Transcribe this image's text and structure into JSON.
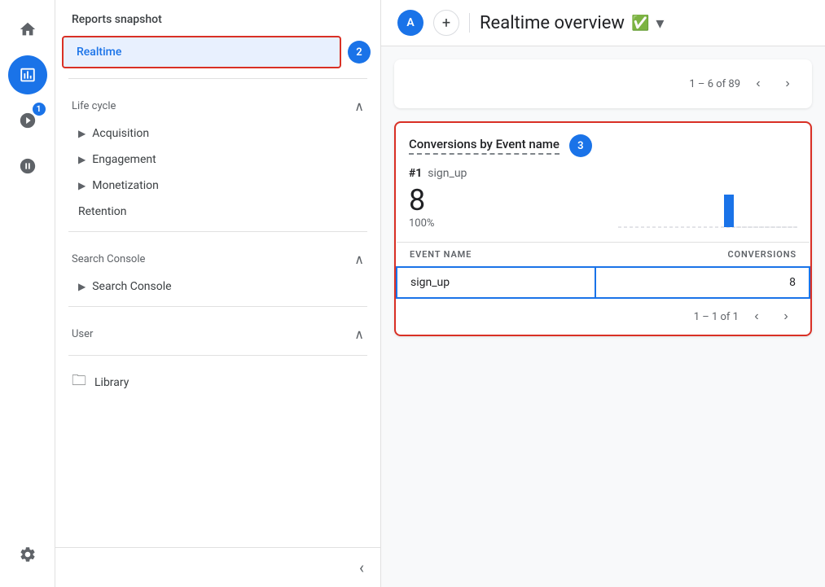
{
  "iconbar": {
    "home_label": "home",
    "reports_label": "reports",
    "advertising_label": "advertising",
    "explore_label": "explore",
    "settings_label": "settings",
    "badge_value": "1"
  },
  "sidebar": {
    "header": "Reports snapshot",
    "realtime_label": "Realtime",
    "lifecycle_label": "Life cycle",
    "acquisition_label": "Acquisition",
    "engagement_label": "Engagement",
    "monetization_label": "Monetization",
    "retention_label": "Retention",
    "search_console_section": "Search Console",
    "search_console_item": "Search Console",
    "user_label": "User",
    "library_label": "Library",
    "collapse_icon": "‹"
  },
  "header": {
    "avatar_label": "A",
    "add_label": "+",
    "page_title": "Realtime overview",
    "step_label": "2"
  },
  "top_card": {
    "pagination_text": "1 – 6 of 89",
    "prev_icon": "‹",
    "next_icon": "›"
  },
  "conversions_card": {
    "title": "Conversions by Event name",
    "step_label": "3",
    "rank": "#1",
    "event_name": "sign_up",
    "big_number": "8",
    "percent": "100%",
    "table_header_event": "EVENT NAME",
    "table_header_conversions": "CONVERSIONS",
    "table_row_event": "sign_up",
    "table_row_value": "8",
    "pagination_text": "1 – 1 of 1",
    "prev_icon": "‹",
    "next_icon": "›"
  }
}
